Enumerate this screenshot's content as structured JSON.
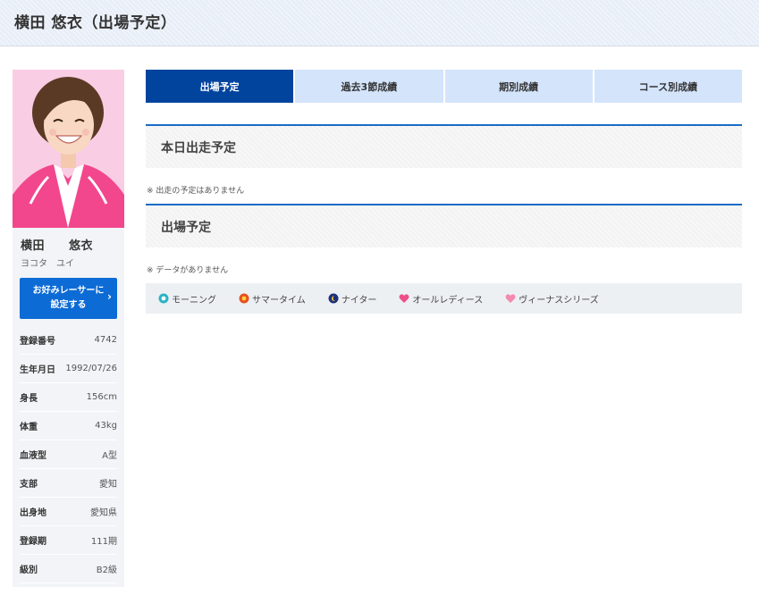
{
  "header": {
    "title": "横田 悠衣（出場予定）"
  },
  "sidebar": {
    "name": "横田　　悠衣",
    "kana": "ヨコタ　ユイ",
    "favorite_button": "お好みレーサーに設定する",
    "favorite_line1": "お好みレーサーに",
    "favorite_line2": "設定する",
    "info": [
      {
        "label": "登録番号",
        "value": "4742"
      },
      {
        "label": "生年月日",
        "value": "1992/07/26"
      },
      {
        "label": "身長",
        "value": "156cm"
      },
      {
        "label": "体重",
        "value": "43kg"
      },
      {
        "label": "血液型",
        "value": "A型"
      },
      {
        "label": "支部",
        "value": "愛知"
      },
      {
        "label": "出身地",
        "value": "愛知県"
      },
      {
        "label": "登録期",
        "value": "111期"
      },
      {
        "label": "級別",
        "value": "B2級"
      }
    ]
  },
  "tabs": [
    {
      "label": "出場予定",
      "active": true
    },
    {
      "label": "過去3節成績",
      "active": false
    },
    {
      "label": "期別成績",
      "active": false
    },
    {
      "label": "コース別成績",
      "active": false
    }
  ],
  "sections": {
    "today": {
      "title": "本日出走予定",
      "note": "※ 出走の予定はありません"
    },
    "schedule": {
      "title": "出場予定",
      "note": "※ データがありません"
    }
  },
  "legend": [
    {
      "label": "モーニング",
      "icon": "morning-icon",
      "color": "#2bb3c6"
    },
    {
      "label": "サマータイム",
      "icon": "summertime-icon",
      "color": "#e8501e"
    },
    {
      "label": "ナイター",
      "icon": "nighter-icon",
      "color": "#1f2f7a"
    },
    {
      "label": "オールレディース",
      "icon": "heart-icon",
      "color": "#ee4f86"
    },
    {
      "label": "ヴィーナスシリーズ",
      "icon": "heart-icon",
      "color": "#f28aad"
    }
  ],
  "colors": {
    "accent": "#00449e",
    "tab_inactive": "#d3e4fb",
    "button": "#0d6bd6"
  }
}
